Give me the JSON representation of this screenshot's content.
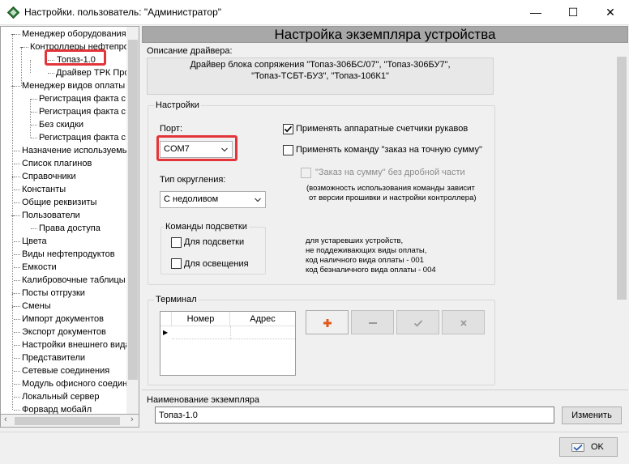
{
  "window": {
    "title": "Настройки. пользователь: \"Администратор\"",
    "min_glyph": "—",
    "max_glyph": "☐",
    "close_glyph": "✕"
  },
  "tree": {
    "items": [
      {
        "label": "Менеджер оборудования",
        "toggle": "−"
      },
      {
        "label": "Контроллеры нефтепродуктов",
        "toggle": "−"
      },
      {
        "label": "Топаз-1.0"
      },
      {
        "label": "Драйвер ТРК Про"
      },
      {
        "label": "Менеджер видов оплаты",
        "toggle": "−"
      },
      {
        "label": "Регистрация факта с"
      },
      {
        "label": "Регистрация факта с"
      },
      {
        "label": "Без скидки"
      },
      {
        "label": "Регистрация факта с"
      },
      {
        "label": "Назначение используемых"
      },
      {
        "label": "Список плагинов"
      },
      {
        "label": "Справочники",
        "toggle": "›"
      },
      {
        "label": "Константы"
      },
      {
        "label": "Общие реквизиты"
      },
      {
        "label": "Пользователи",
        "toggle": "−"
      },
      {
        "label": "Права доступа"
      },
      {
        "label": "Цвета"
      },
      {
        "label": "Виды нефтепродуктов"
      },
      {
        "label": "Емкости"
      },
      {
        "label": "Калибровочные таблицы"
      },
      {
        "label": "Посты отгрузки",
        "toggle": "›"
      },
      {
        "label": "Смены",
        "toggle": "›"
      },
      {
        "label": "Импорт документов"
      },
      {
        "label": "Экспорт документов"
      },
      {
        "label": "Настройки внешнего вида"
      },
      {
        "label": "Представители"
      },
      {
        "label": "Сетевые соединения"
      },
      {
        "label": "Модуль офисного соединения"
      },
      {
        "label": "Локальный сервер"
      },
      {
        "label": "Форвард мобайл"
      }
    ],
    "scroll_left": "‹",
    "scroll_right": "›"
  },
  "header": {
    "title": "Настройка экземпляра устройства"
  },
  "driver": {
    "label": "Описание драйвера:",
    "line1": "Драйвер блока сопряжения \"Топаз-306БС/07\", \"Топаз-306БУ7\",",
    "line2": "\"Топаз-ТСБТ-БУ3\", \"Топаз-106К1\""
  },
  "settings": {
    "group_label": "Настройки",
    "port_label": "Порт:",
    "port_value": "COM7",
    "rounding_label": "Тип округления:",
    "rounding_value": "С недоливом",
    "backlight_group_label": "Команды подсветки",
    "backlight_label": "Для подсветки",
    "lighting_label": "Для освещения",
    "hw_counters_label": "Применять аппаратные счетчики рукавов",
    "exact_order_label": "Применять команду \"заказ на точную сумму\"",
    "no_fraction_label": "\"Заказ на сумму\" без дробной части",
    "note_line1": "(возможность использования команды зависит",
    "note_line2": "от версии прошивки и настройки контроллера)",
    "legacy_line1": "для устаревших устройств,",
    "legacy_line2": "не поддеживающих виды оплаты,",
    "legacy_line3": "код наличного вида оплаты - 001",
    "legacy_line4": "код безналичного вида оплаты - 004",
    "hw_counters_checked": true,
    "exact_order_checked": false,
    "no_fraction_checked": false,
    "backlight_checked": false,
    "lighting_checked": false
  },
  "terminal": {
    "group_label": "Терминал",
    "col_number": "Номер",
    "col_address": "Адрес",
    "row_marker": "▶"
  },
  "instance": {
    "label": "Наименование экземпляра",
    "value": "Топаз-1.0",
    "rename_button": "Изменить"
  },
  "footer": {
    "ok_label": "OK"
  },
  "colors": {
    "highlight": "#e3343a",
    "header_bg": "#a8a8a8",
    "plus": "#e05a1e"
  }
}
